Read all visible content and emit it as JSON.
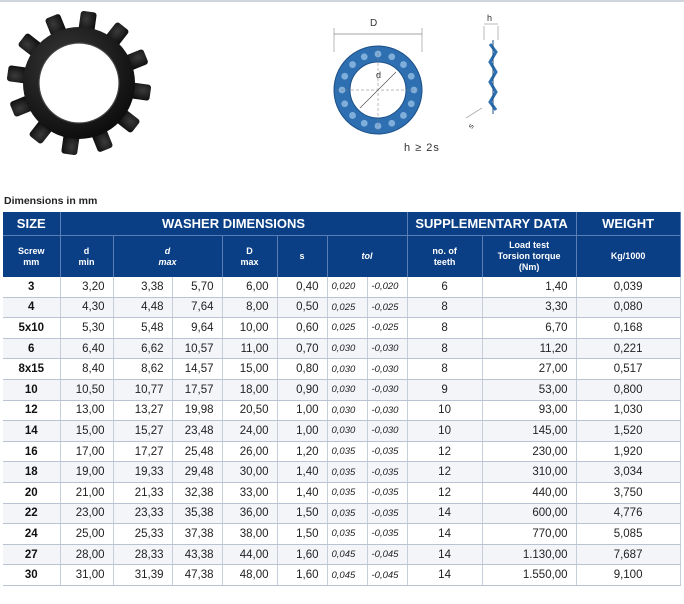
{
  "drawing": {
    "D_label": "D",
    "d_label": "d",
    "h_label": "h",
    "s_label": "s",
    "relation": "h ≥ 2s"
  },
  "caption": "Dimensions in mm",
  "header": {
    "groups": [
      "SIZE",
      "WASHER DIMENSIONS",
      "SUPPLEMENTARY DATA",
      "WEIGHT"
    ],
    "columns": [
      {
        "line1": "Screw",
        "line2": "mm"
      },
      {
        "line1": "d",
        "line2": "min"
      },
      {
        "line1": "d",
        "line2": "max"
      },
      {
        "line1": "D",
        "line2": "max"
      },
      {
        "line1": "s",
        "line2": ""
      },
      {
        "line1": "tol",
        "line2": ""
      },
      {
        "line1": "no. of",
        "line2": "teeth"
      },
      {
        "line1": "Load test",
        "line2": "Torsion torque",
        "line3": "(Nm)"
      },
      {
        "line1": "Kg/1000",
        "line2": ""
      }
    ]
  },
  "rows": [
    [
      "3",
      "3,20",
      "3,38",
      "5,70",
      "6,00",
      "0,40",
      "0,020",
      "-0,020",
      "6",
      "1,40",
      "0,039"
    ],
    [
      "4",
      "4,30",
      "4,48",
      "7,64",
      "8,00",
      "0,50",
      "0,025",
      "-0,025",
      "8",
      "3,30",
      "0,080"
    ],
    [
      "5x10",
      "5,30",
      "5,48",
      "9,64",
      "10,00",
      "0,60",
      "0,025",
      "-0,025",
      "8",
      "6,70",
      "0,168"
    ],
    [
      "6",
      "6,40",
      "6,62",
      "10,57",
      "11,00",
      "0,70",
      "0,030",
      "-0,030",
      "8",
      "11,20",
      "0,221"
    ],
    [
      "8x15",
      "8,40",
      "8,62",
      "14,57",
      "15,00",
      "0,80",
      "0,030",
      "-0,030",
      "8",
      "27,00",
      "0,517"
    ],
    [
      "10",
      "10,50",
      "10,77",
      "17,57",
      "18,00",
      "0,90",
      "0,030",
      "-0,030",
      "9",
      "53,00",
      "0,800"
    ],
    [
      "12",
      "13,00",
      "13,27",
      "19,98",
      "20,50",
      "1,00",
      "0,030",
      "-0,030",
      "10",
      "93,00",
      "1,030"
    ],
    [
      "14",
      "15,00",
      "15,27",
      "23,48",
      "24,00",
      "1,00",
      "0,030",
      "-0,030",
      "10",
      "145,00",
      "1,520"
    ],
    [
      "16",
      "17,00",
      "17,27",
      "25,48",
      "26,00",
      "1,20",
      "0,035",
      "-0,035",
      "12",
      "230,00",
      "1,920"
    ],
    [
      "18",
      "19,00",
      "19,33",
      "29,48",
      "30,00",
      "1,40",
      "0,035",
      "-0,035",
      "12",
      "310,00",
      "3,034"
    ],
    [
      "20",
      "21,00",
      "21,33",
      "32,38",
      "33,00",
      "1,40",
      "0,035",
      "-0,035",
      "12",
      "440,00",
      "3,750"
    ],
    [
      "22",
      "23,00",
      "23,33",
      "35,38",
      "36,00",
      "1,50",
      "0,035",
      "-0,035",
      "14",
      "600,00",
      "4,776"
    ],
    [
      "24",
      "25,00",
      "25,33",
      "37,38",
      "38,00",
      "1,50",
      "0,035",
      "-0,035",
      "14",
      "770,00",
      "5,085"
    ],
    [
      "27",
      "28,00",
      "28,33",
      "43,38",
      "44,00",
      "1,60",
      "0,045",
      "-0,045",
      "14",
      "1.130,00",
      "7,687"
    ],
    [
      "30",
      "31,00",
      "31,39",
      "47,38",
      "48,00",
      "1,60",
      "0,045",
      "-0,045",
      "14",
      "1.550,00",
      "9,100"
    ]
  ],
  "colors": {
    "header_bg": "#0a3f86",
    "washer_blue": "#2d6fb0"
  }
}
